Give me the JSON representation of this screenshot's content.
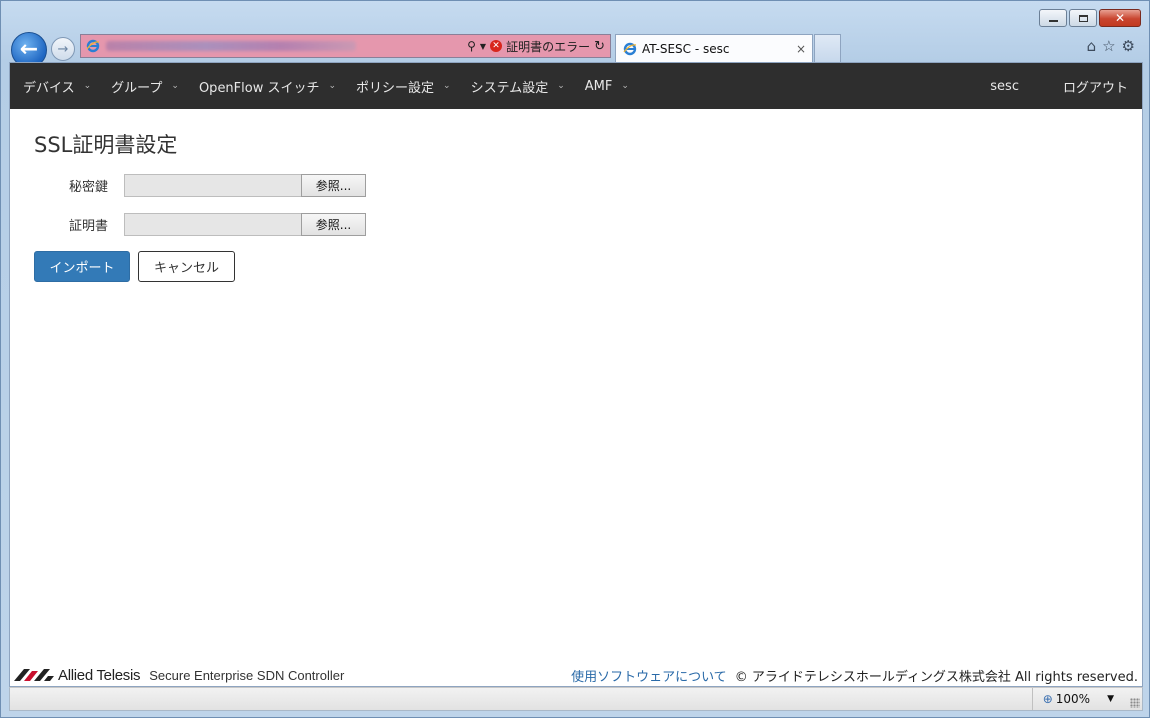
{
  "browser": {
    "address_error_label": "証明書のエラー",
    "tab_title": "AT-SESC - sesc",
    "tab_close": "×",
    "zoom_level": "100%"
  },
  "navbar": {
    "items": [
      {
        "label": "デバイス"
      },
      {
        "label": "グループ"
      },
      {
        "label": "OpenFlow スイッチ"
      },
      {
        "label": "ポリシー設定"
      },
      {
        "label": "システム設定"
      },
      {
        "label": "AMF"
      }
    ],
    "user": "sesc",
    "logout": "ログアウト"
  },
  "page": {
    "title": "SSL証明書設定",
    "fields": [
      {
        "label": "秘密鍵",
        "browse": "参照..."
      },
      {
        "label": "証明書",
        "browse": "参照..."
      }
    ],
    "import_button": "インポート",
    "cancel_button": "キャンセル"
  },
  "footer": {
    "brand": "Allied Telesis",
    "product": "Secure Enterprise SDN Controller",
    "software_link": "使用ソフトウェアについて",
    "copyright": "© アライドテレシスホールディングス株式会社 All rights reserved."
  },
  "colors": {
    "navbar_bg": "#2e2e2e",
    "primary_button": "#337ab7",
    "link": "#2a6aa8",
    "address_bar_error": "#e597ad"
  }
}
